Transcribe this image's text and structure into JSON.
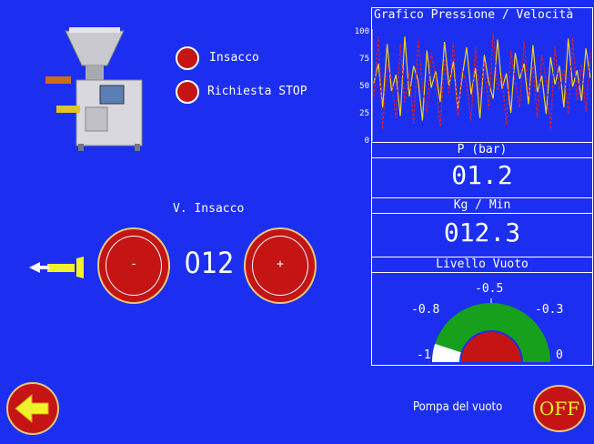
{
  "machine": {
    "icon": "sausage-stuffer-machine-icon"
  },
  "indicators": [
    {
      "label": "Insacco",
      "color": "#c41414"
    },
    {
      "label": "Richiesta STOP",
      "color": "#c41414"
    }
  ],
  "speed": {
    "title": "V. Insacco",
    "value": "012",
    "minus": "-",
    "plus": "+"
  },
  "direction_icon": "left-arrow-icon",
  "back_icon": "back-arrow-icon",
  "chart": {
    "title": "Grafico Pressione / Velocità",
    "yticks": [
      "100",
      "75",
      "50",
      "25",
      "0"
    ]
  },
  "chart_data": {
    "type": "line",
    "ylim": [
      0,
      100
    ],
    "title": "Grafico Pressione / Velocità",
    "series": [
      {
        "color": "#f2d21a",
        "values": [
          52,
          70,
          30,
          88,
          45,
          60,
          22,
          95,
          40,
          68,
          55,
          18,
          82,
          48,
          63,
          35,
          90,
          50,
          72,
          28,
          58,
          85,
          42,
          66,
          20,
          78,
          53,
          38,
          92,
          47,
          61,
          25,
          80,
          56,
          70,
          33,
          87,
          44,
          59,
          24,
          76,
          51,
          68,
          30,
          93,
          49,
          64,
          36,
          84,
          57
        ]
      },
      {
        "color": "#e01e1e",
        "values": [
          40,
          95,
          10,
          70,
          55,
          20,
          88,
          35,
          62,
          15,
          92,
          48,
          25,
          80,
          58,
          12,
          75,
          42,
          90,
          22,
          66,
          50,
          18,
          85,
          38,
          72,
          28,
          98,
          45,
          60,
          14,
          82,
          52,
          30,
          90,
          40,
          68,
          20,
          78,
          55,
          10,
          86,
          46,
          64,
          24,
          94,
          36,
          70,
          26,
          80
        ]
      }
    ]
  },
  "pressure": {
    "header": "P (bar)",
    "value": "01.2"
  },
  "flow": {
    "header": "Kg / Min",
    "value": "012.3"
  },
  "vacuum": {
    "header": "Livello Vuoto",
    "ticks": {
      "t05": "-0.5",
      "t08": "-0.8",
      "t03": "-0.3",
      "t1": "-1",
      "t0": "0"
    },
    "level": -0.9
  },
  "pump": {
    "label": "Pompa del vuoto",
    "state": "OFF"
  }
}
